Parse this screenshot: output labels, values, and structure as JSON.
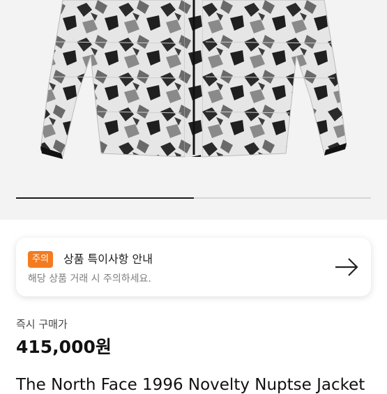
{
  "product": {
    "image_alt": "snow mountain print down jacket",
    "carousel_progress": 0.5,
    "title": "The North Face 1996 Novelty Nuptse Jacket"
  },
  "notice": {
    "badge": "주의",
    "title": "상품 특이사항 안내",
    "subtitle": "해당 상품 거래 시 주의하세요."
  },
  "price": {
    "label": "즉시 구매가",
    "value": "415,000원"
  },
  "colors": {
    "badge": "#f47b20",
    "hero_bg": "#f3f3f3"
  }
}
